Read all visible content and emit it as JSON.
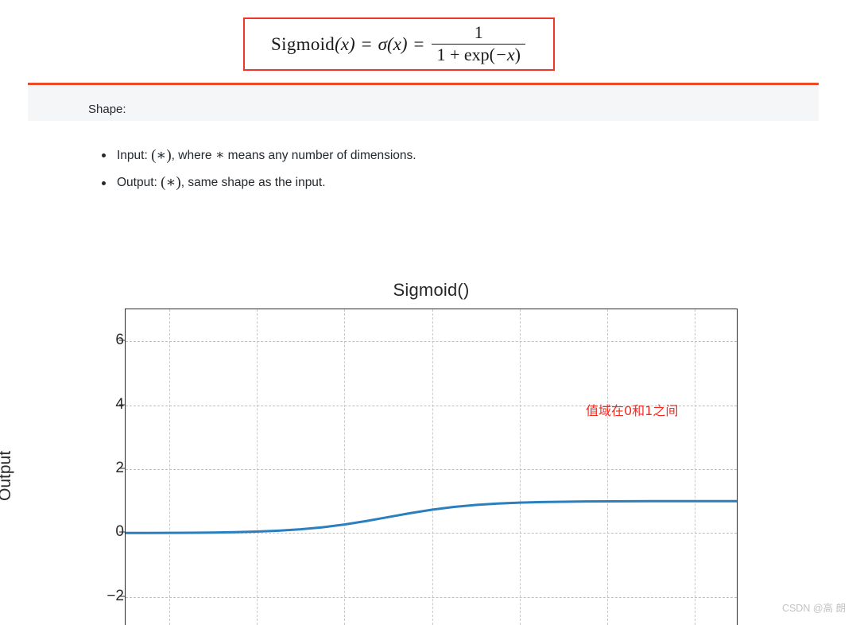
{
  "formula": {
    "lhs_name": "Sigmoid",
    "lhs_arg": "(x)",
    "eq1": "=",
    "sigma": "σ",
    "sigma_arg": "(x)",
    "eq2": "=",
    "numerator": "1",
    "denominator_prefix": "1 + exp(",
    "denominator_arg": "−x",
    "denominator_suffix": ")",
    "border_color": "#f0352a"
  },
  "shape": {
    "header_label": "Shape:",
    "header_accent_color": "#ed4a27",
    "items": [
      {
        "prefix": "Input: ",
        "paren": "(∗)",
        "suffix": ", where ",
        "star": "∗",
        "tail": " means any number of dimensions."
      },
      {
        "prefix": "Output: ",
        "paren": "(∗)",
        "suffix": ", same shape as the input.",
        "star": "",
        "tail": ""
      }
    ]
  },
  "chart_data": {
    "type": "line",
    "title": "Sigmoid()",
    "xlabel": "",
    "ylabel": "Output",
    "ylim": [
      -2.9,
      7.0
    ],
    "xlim": [
      -6.0,
      8.0
    ],
    "yticks": [
      6,
      4,
      2,
      0,
      -2
    ],
    "ytick_labels": [
      "6",
      "4",
      "2",
      "0",
      "−2"
    ],
    "xticks": [
      -5,
      -3,
      -1,
      1,
      3,
      5,
      7
    ],
    "grid": true,
    "legend": "none",
    "line_color": "#2a7fbf",
    "line_width": 3,
    "annotations": [
      {
        "text": "值域在0和1之间",
        "color": "#f22a22",
        "x": 3.4,
        "y": 4.0
      }
    ],
    "series": [
      {
        "name": "Sigmoid(x)",
        "x": [
          -6.0,
          -5.5,
          -5.0,
          -4.5,
          -4.0,
          -3.5,
          -3.0,
          -2.5,
          -2.0,
          -1.5,
          -1.0,
          -0.5,
          0.0,
          0.5,
          1.0,
          1.5,
          2.0,
          2.5,
          3.0,
          3.5,
          4.0,
          4.5,
          5.0,
          5.5,
          6.0,
          6.5,
          7.0,
          7.5,
          8.0
        ],
        "y": [
          0.0025,
          0.0041,
          0.0067,
          0.011,
          0.018,
          0.0293,
          0.0474,
          0.0759,
          0.1192,
          0.1824,
          0.2689,
          0.3775,
          0.5,
          0.6225,
          0.7311,
          0.8176,
          0.8808,
          0.9241,
          0.9526,
          0.9707,
          0.982,
          0.989,
          0.9933,
          0.9959,
          0.9975,
          0.9985,
          0.9991,
          0.9994,
          0.9997
        ]
      }
    ]
  },
  "watermark": {
    "text": "CSDN @高 朗"
  }
}
